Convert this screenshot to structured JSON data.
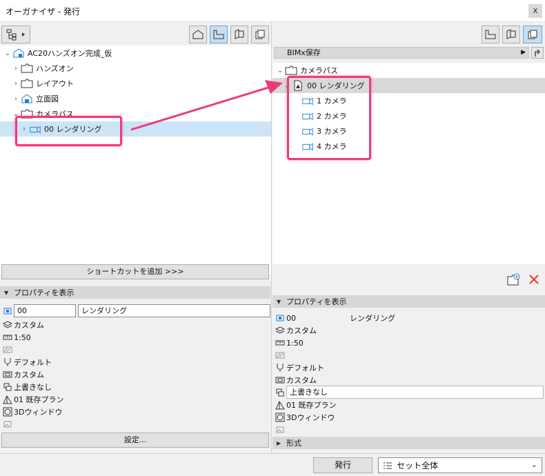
{
  "window": {
    "title": "オーガナイザ - 発行",
    "close_label": "x"
  },
  "left": {
    "tree": [
      {
        "label": "AC20ハンズオン完成_仮",
        "icon": "project-house-icon",
        "twisty": "expanded"
      },
      {
        "label": "ハンズオン",
        "icon": "folder-icon",
        "twisty": "collapsed"
      },
      {
        "label": "レイアウト",
        "icon": "folder-icon",
        "twisty": "collapsed"
      },
      {
        "label": "立面図",
        "icon": "elevation-icon",
        "twisty": "collapsed"
      },
      {
        "label": "カメラパス",
        "icon": "folder-icon",
        "twisty": "expanded"
      },
      {
        "label": "00 レンダリング",
        "icon": "camera-icon",
        "twisty": "collapsed",
        "selected": true
      }
    ],
    "add_shortcut_label": "ショートカットを追加 >>>",
    "props_header": "プロパティを表示",
    "props": {
      "id_value": "00",
      "name_value": "レンダリング",
      "layer": "カスタム",
      "scale": "1:50",
      "structure": "デフォルト",
      "pen": "カスタム",
      "override": "上書きなし",
      "plan": "01 既存プラン",
      "window3d": "3Dウィンドウ"
    },
    "settings_label": "設定..."
  },
  "right": {
    "path_label": "BIMx保存",
    "tree": [
      {
        "label": "カメラパス",
        "icon": "folder-icon",
        "twisty": "expanded"
      },
      {
        "label": "00 レンダリング",
        "icon": "render-doc-icon",
        "twisty": "expanded",
        "highlight": true
      },
      {
        "label": "1 カメラ",
        "icon": "camera-icon"
      },
      {
        "label": "2 カメラ",
        "icon": "camera-icon"
      },
      {
        "label": "3 カメラ",
        "icon": "camera-icon"
      },
      {
        "label": "4 カメラ",
        "icon": "camera-icon"
      }
    ],
    "props_header": "プロパティを表示",
    "props": {
      "id_value": "00",
      "name_value": "レンダリング",
      "layer": "カスタム",
      "scale": "1:50",
      "structure": "デフォルト",
      "pen": "カスタム",
      "override": "上書きなし",
      "plan": "01 既存プラン",
      "window3d": "3Dウィンドウ"
    },
    "format_header": "形式"
  },
  "bottom": {
    "publish_label": "発行",
    "set_value": "セット全体"
  },
  "colors": {
    "highlight": "#ee3a78",
    "selection": "#cce4f7",
    "accent": "#1e7bd0",
    "delete": "#e8452c"
  }
}
